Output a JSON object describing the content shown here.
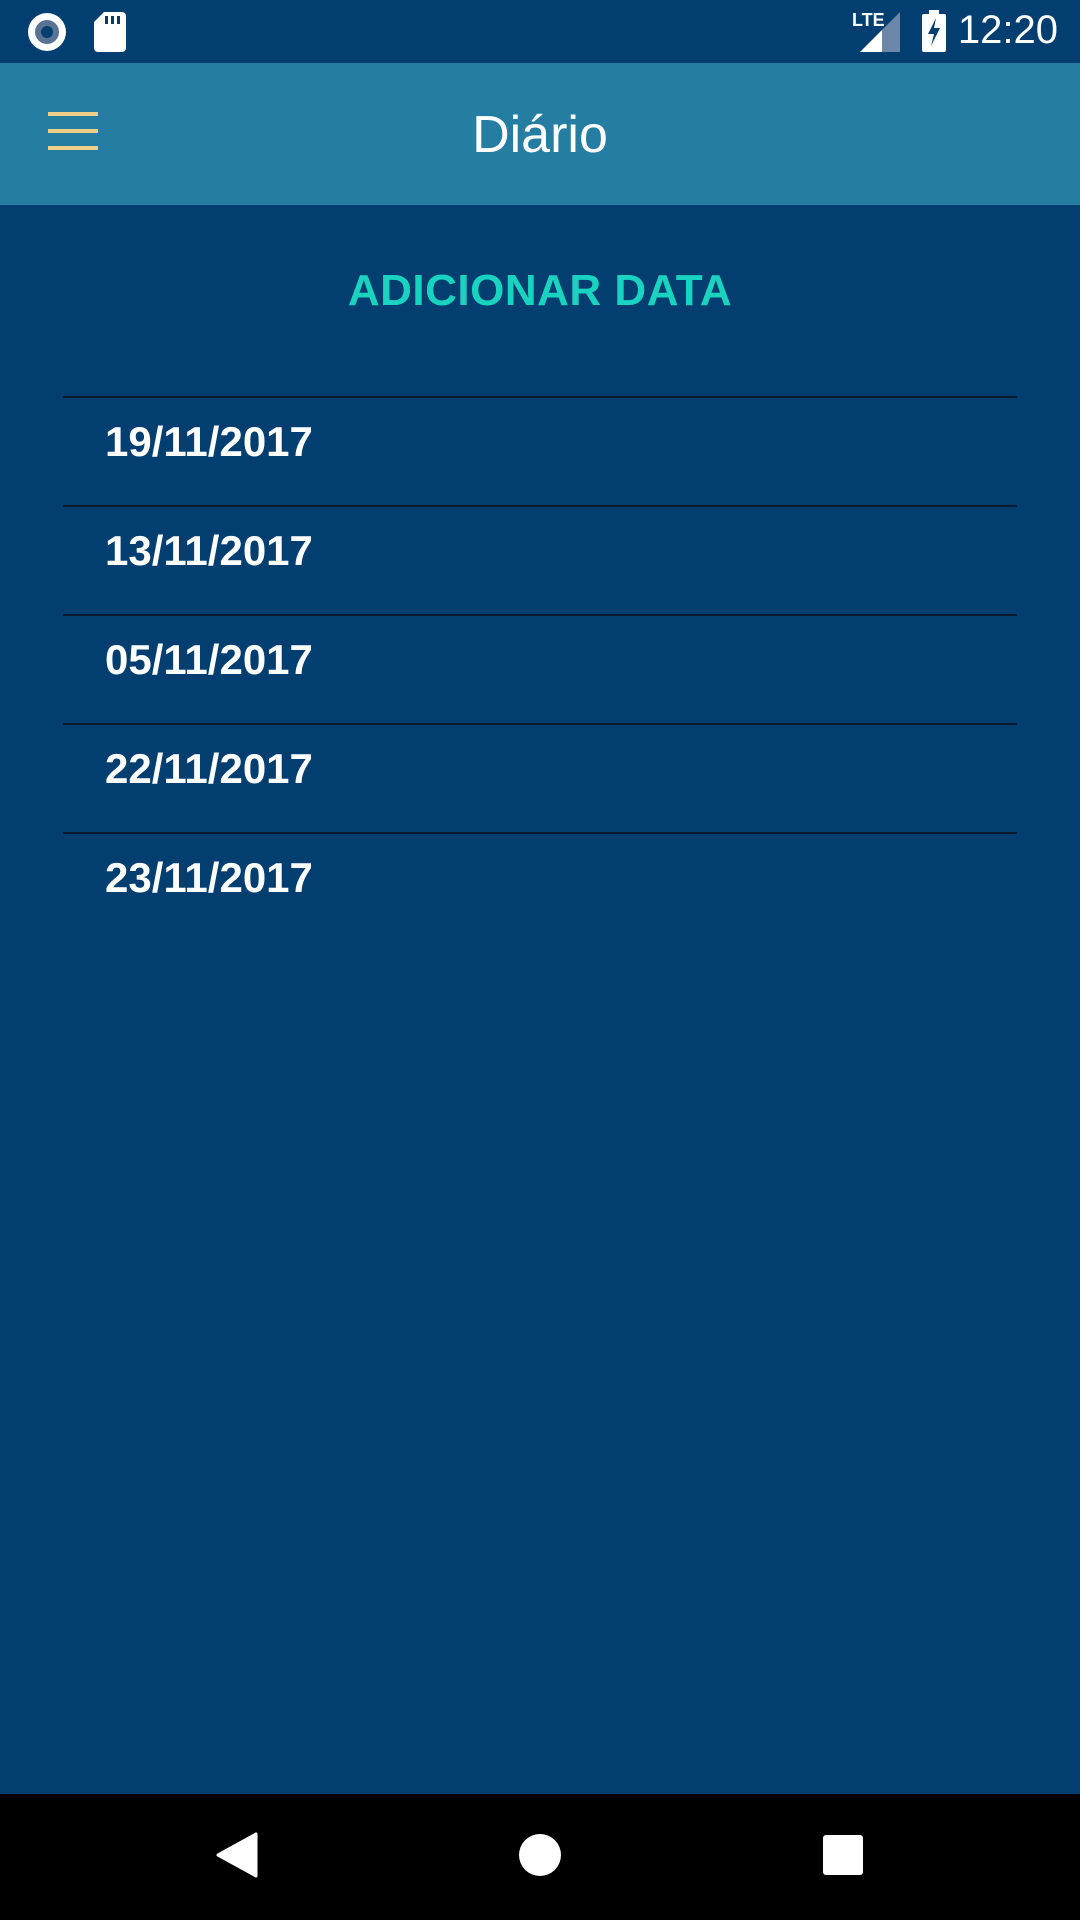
{
  "status_bar": {
    "time": "12:20",
    "network": "LTE",
    "icons": [
      "radio-record-icon",
      "sd-card-icon",
      "lte-signal-icon",
      "battery-charging-icon"
    ]
  },
  "app_bar": {
    "title": "Diário",
    "menu_icon": "hamburger-menu-icon"
  },
  "main": {
    "add_date_label": "ADICIONAR DATA",
    "dates": [
      "19/11/2017",
      "13/11/2017",
      "05/11/2017",
      "22/11/2017",
      "23/11/2017"
    ]
  },
  "nav_bar": {
    "icons": [
      "back-icon",
      "home-icon",
      "recents-icon"
    ]
  },
  "colors": {
    "background": "#023e70",
    "app_bar": "#257ea1",
    "accent": "#19d3c0",
    "menu_icon": "#f0cf8a",
    "divider": "#0a1a2c",
    "text": "#ffffff"
  }
}
